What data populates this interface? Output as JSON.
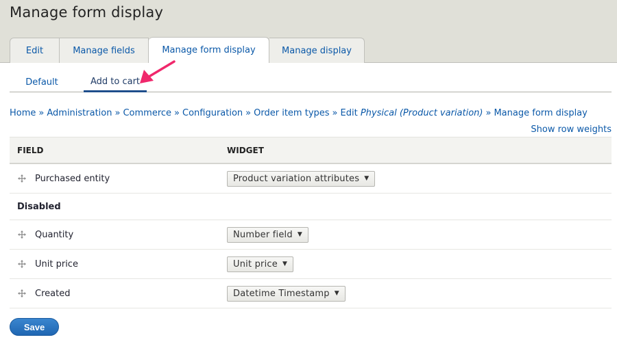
{
  "header": {
    "title": "Manage form display",
    "tabs": [
      {
        "label": "Edit",
        "active": false
      },
      {
        "label": "Manage fields",
        "active": false
      },
      {
        "label": "Manage form display",
        "active": true
      },
      {
        "label": "Manage display",
        "active": false
      }
    ]
  },
  "subtabs": [
    {
      "label": "Default",
      "active": false
    },
    {
      "label": "Add to cart",
      "active": true
    }
  ],
  "annotation": {
    "type": "arrow-icon",
    "color": "#f0286c",
    "points_to": "Add to cart"
  },
  "breadcrumb": {
    "items": [
      "Home",
      "Administration",
      "Commerce",
      "Configuration",
      "Order item types"
    ],
    "edit_prefix": "Edit",
    "edit_italic": "Physical (Product variation)",
    "last": "Manage form display",
    "separator": "»"
  },
  "row_weights_link": "Show row weights",
  "table": {
    "headers": {
      "field": "FIELD",
      "widget": "WIDGET"
    },
    "enabled_rows": [
      {
        "field": "Purchased entity",
        "widget": "Product variation attributes"
      }
    ],
    "disabled_label": "Disabled",
    "disabled_rows": [
      {
        "field": "Quantity",
        "widget": "Number field"
      },
      {
        "field": "Unit price",
        "widget": "Unit price"
      },
      {
        "field": "Created",
        "widget": "Datetime Timestamp"
      }
    ]
  },
  "actions": {
    "save_label": "Save"
  },
  "colors": {
    "link": "#0a58a8",
    "primary_button": "#2b74c1",
    "header_bg": "#e0e0d8"
  }
}
